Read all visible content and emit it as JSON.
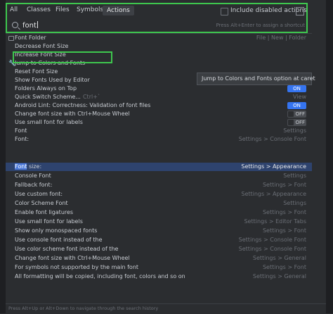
{
  "tabs": [
    {
      "label": "All"
    },
    {
      "label": "Classes"
    },
    {
      "label": "Files"
    },
    {
      "label": "Symbols"
    },
    {
      "label": "Actions",
      "active": true
    }
  ],
  "include_disabled_label": "Include disabled actions",
  "search": {
    "value": "font",
    "hint": "Press Alt+Enter to assign a shortcut"
  },
  "tooltip": "Jump to Colors and Fonts option at caret",
  "rows": [
    {
      "label": "Font Folder",
      "right": "File | New | Folder",
      "icon": "folder-icon"
    },
    {
      "label": "Decrease Font Size",
      "right": ""
    },
    {
      "label": "Increase Font Size",
      "right": ""
    },
    {
      "label": "Jump to Colors and Fonts",
      "right": "",
      "icon": "wrench-icon"
    },
    {
      "label": "Reset Font Size",
      "right": ""
    },
    {
      "label": "Show Fonts Used by Editor",
      "right": ""
    },
    {
      "label": "Folders Always on Top",
      "right": "",
      "toggle": "ON"
    },
    {
      "label": "Quick Switch Scheme...",
      "shortcut": "Ctrl+`",
      "right": "View"
    },
    {
      "label": "Android Lint: Correctness: Validation of font files",
      "right": "",
      "toggle": "ON"
    },
    {
      "label": "Change font size with Ctrl+Mouse Wheel",
      "right": "",
      "toggle": "OFF"
    },
    {
      "label": "Use small font for labels",
      "right": "",
      "toggle": "OFF"
    },
    {
      "label": "Font",
      "right": "Settings"
    },
    {
      "label": "Font:",
      "right": "Settings > Console Font"
    },
    {
      "label_mark": "Font",
      "label_rest": " size:",
      "right": "Settings > Appearance",
      "selected": true
    },
    {
      "label": "Console Font",
      "right": "Settings"
    },
    {
      "label": "Fallback font:",
      "right": "Settings > Font"
    },
    {
      "label": "Use custom font:",
      "right": "Settings > Appearance"
    },
    {
      "label": "Color Scheme Font",
      "right": "Settings"
    },
    {
      "label": "Enable font ligatures",
      "right": "Settings > Font"
    },
    {
      "label": "Use small font for labels",
      "right": "Settings > Editor Tabs"
    },
    {
      "label": "Show only monospaced fonts",
      "right": "Settings > Font"
    },
    {
      "label": "Use console font instead of the",
      "right": "Settings > Console Font"
    },
    {
      "label": "Use color scheme font instead of the",
      "right": "Settings > Console Font"
    },
    {
      "label": "Change font size with Ctrl+Mouse Wheel",
      "right": "Settings > General"
    },
    {
      "label": "For symbols not supported by the main font",
      "right": "Settings > Font"
    },
    {
      "label": "All formatting will be copied, including font, colors and so on",
      "right": "Settings > General"
    }
  ],
  "footer": "Press Alt+Up or Alt+Down to navigate through the search history",
  "colors": {
    "background": "#2b2d30",
    "selection": "#2e436e",
    "toggle_on": "#3574f0",
    "highlight_box": "#3ec74e"
  }
}
